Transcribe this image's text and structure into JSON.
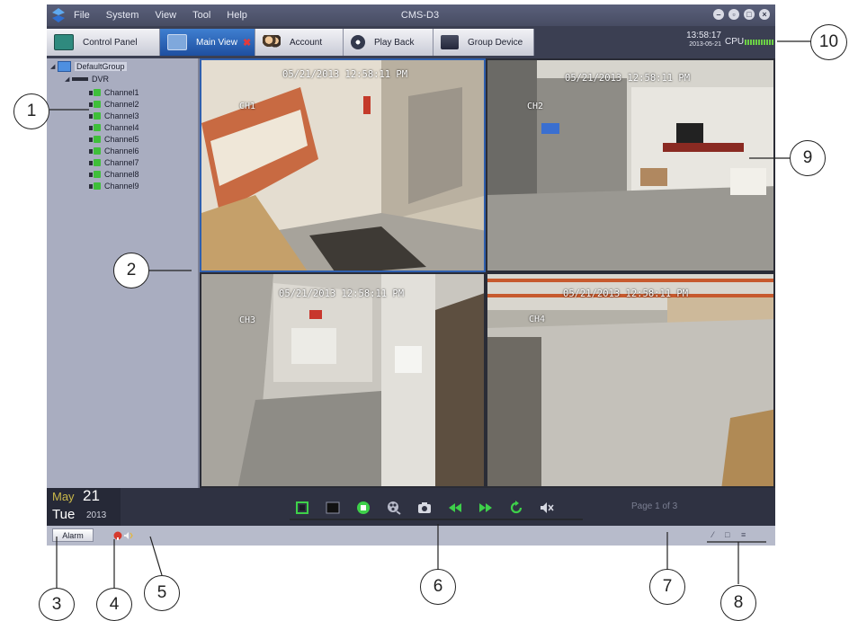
{
  "window": {
    "menu": [
      "File",
      "System",
      "View",
      "Tool",
      "Help"
    ],
    "title": "CMS-D3",
    "controls": [
      "minimize",
      "restore",
      "maximize",
      "close"
    ]
  },
  "tabs": [
    {
      "label": "Control Panel",
      "icon": "control-panel-icon",
      "active": false
    },
    {
      "label": "Main View",
      "icon": "monitor-icon",
      "active": true,
      "closable": true
    },
    {
      "label": "Account",
      "icon": "users-icon",
      "active": false
    },
    {
      "label": "Play Back",
      "icon": "playback-icon",
      "active": false
    },
    {
      "label": "Group Device",
      "icon": "device-icon",
      "active": false
    }
  ],
  "status_top": {
    "time": "13:58:17",
    "date": "2013-05-21",
    "cpu_label": "CPU"
  },
  "tree": {
    "group": "DefaultGroup",
    "device": "DVR",
    "channels": [
      "Channel1",
      "Channel2",
      "Channel3",
      "Channel4",
      "Channel5",
      "Channel6",
      "Channel7",
      "Channel8",
      "Channel9"
    ]
  },
  "views": [
    {
      "timestamp": "05/21/2013 12:58:11 PM",
      "channel": "CH1"
    },
    {
      "timestamp": "05/21/2013 12:58:11 PM",
      "channel": "CH2"
    },
    {
      "timestamp": "05/21/2013 12:58:11 PM",
      "channel": "CH3"
    },
    {
      "timestamp": "05/21/2013 12:58:11 PM",
      "channel": "CH4"
    }
  ],
  "date_panel": {
    "month": "May",
    "day": "21",
    "weekday": "Tue",
    "year": "2013"
  },
  "controls": [
    "fullscreen-icon",
    "single-view-icon",
    "stop-icon",
    "record-icon",
    "snapshot-icon",
    "rewind-icon",
    "forward-icon",
    "refresh-icon",
    "mute-icon"
  ],
  "page_info": "Page 1 of 3",
  "status_bottom": {
    "alarm_label": "Alarm",
    "window_icons": [
      "pin-icon",
      "restore-icon",
      "menu-icon"
    ]
  },
  "annotations": [
    "1",
    "2",
    "3",
    "4",
    "5",
    "6",
    "7",
    "8",
    "9",
    "10"
  ],
  "colors": {
    "accent": "#2f5fae",
    "channel_online": "#3fbf3a",
    "cpu_meter": "#6cd046",
    "close": "#e53a3a"
  }
}
